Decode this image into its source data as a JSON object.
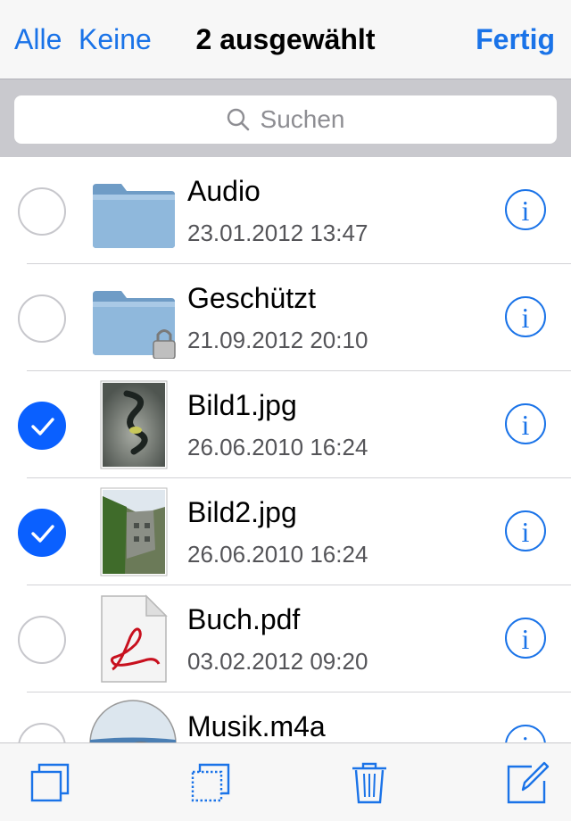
{
  "navbar": {
    "select_all": "Alle",
    "select_none": "Keine",
    "title": "2 ausgewählt",
    "done": "Fertig"
  },
  "search": {
    "placeholder": "Suchen"
  },
  "files": [
    {
      "name": "Audio",
      "date": "23.01.2012 13:47",
      "type": "folder",
      "selected": false
    },
    {
      "name": "Geschützt",
      "date": "21.09.2012 20:10",
      "type": "folder-locked",
      "selected": false
    },
    {
      "name": "Bild1.jpg",
      "date": "26.06.2010 16:24",
      "type": "image",
      "selected": true
    },
    {
      "name": "Bild2.jpg",
      "date": "26.06.2010 16:24",
      "type": "image",
      "selected": true
    },
    {
      "name": "Buch.pdf",
      "date": "03.02.2012 09:20",
      "type": "pdf",
      "selected": false
    },
    {
      "name": "Musik.m4a",
      "date": "",
      "type": "audio",
      "selected": false
    }
  ],
  "toolbar": {
    "icons": [
      "copy-icon",
      "duplicate-icon",
      "trash-icon",
      "compose-icon"
    ]
  },
  "colors": {
    "accent": "#1a73e8",
    "checked": "#0a60ff",
    "folder": "#8fb8dc"
  }
}
